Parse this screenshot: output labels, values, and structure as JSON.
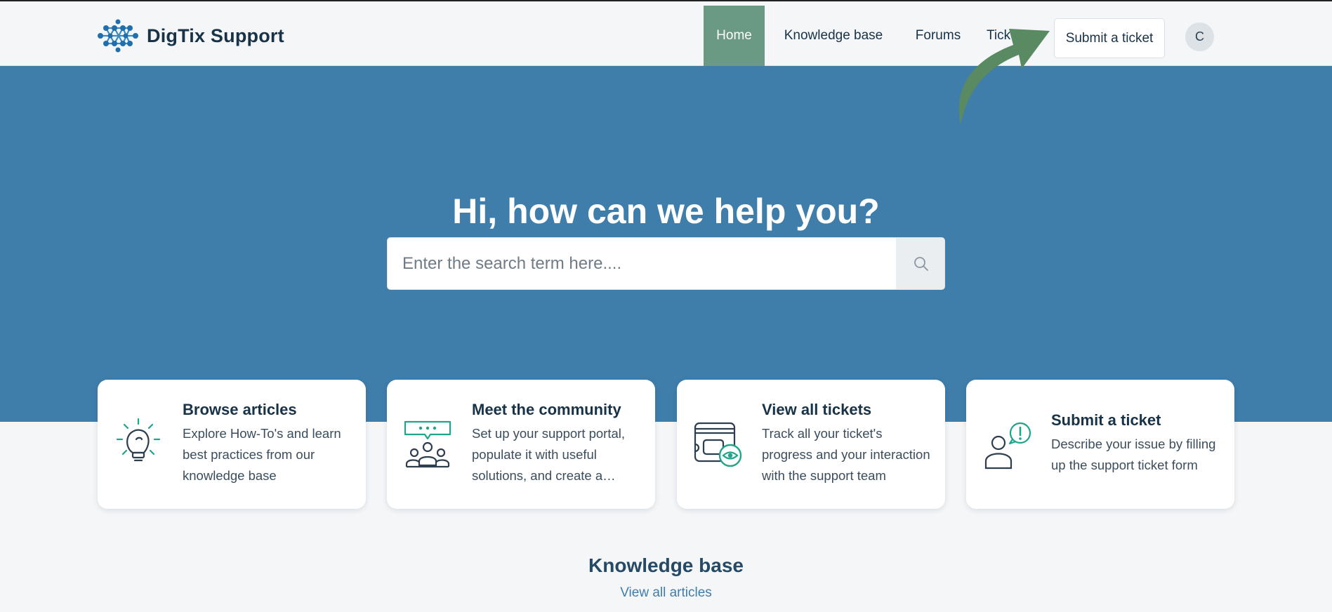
{
  "header": {
    "brand": "DigTix Support",
    "nav": [
      "Home",
      "Knowledge base",
      "Forums",
      "Tickets"
    ],
    "submit_button": "Submit a ticket",
    "avatar_initial": "C"
  },
  "hero": {
    "title": "Hi, how can we help you?",
    "search_placeholder": "Enter the search term here....",
    "search_value": ""
  },
  "cards": [
    {
      "title": "Browse articles",
      "desc": "Explore How-To's and learn best practices from our knowledge base",
      "icon": "lightbulb-icon"
    },
    {
      "title": "Meet the community",
      "desc": "Set up your support portal, populate it with useful solutions, and create a community forum",
      "icon": "community-icon"
    },
    {
      "title": "View all tickets",
      "desc": "Track all your ticket's progress and your interaction with the support team",
      "icon": "tickets-view-icon"
    },
    {
      "title": "Submit a ticket",
      "desc": "Describe your issue by filling up the support ticket form",
      "icon": "submit-ticket-icon"
    }
  ],
  "knowledge_base": {
    "title": "Knowledge base",
    "link": "View all articles"
  },
  "colors": {
    "hero_bg": "#3f7dab",
    "nav_active": "#6a9a83",
    "accent_green": "#1fa58a",
    "arrow": "#5a8a62",
    "text_dark": "#183247"
  }
}
